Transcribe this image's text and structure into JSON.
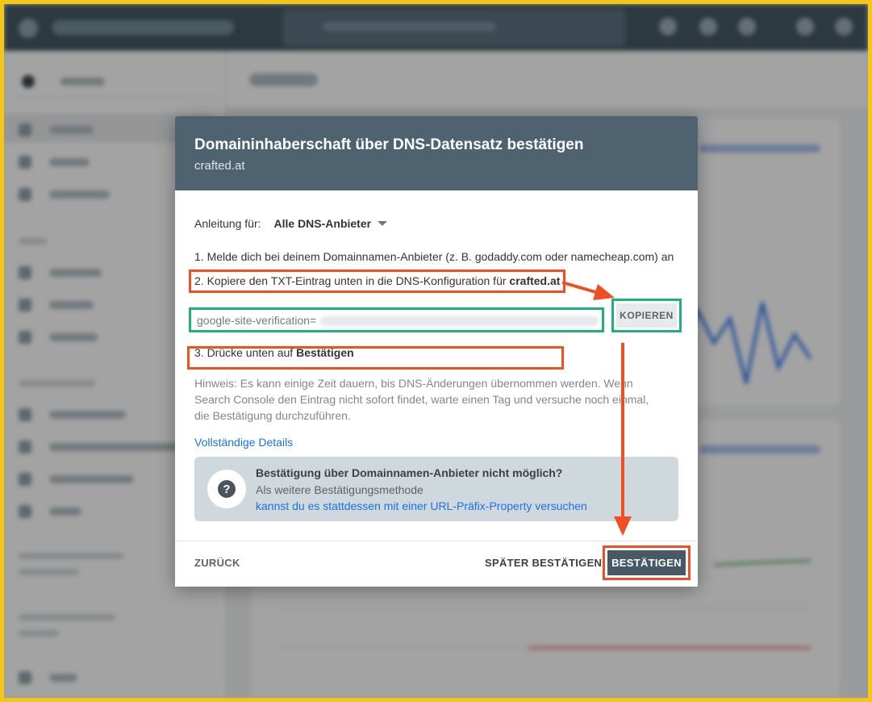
{
  "dialog": {
    "title": "Domaininhaberschaft über DNS-Datensatz bestätigen",
    "subtitle": "crafted.at",
    "instructions_label": "Anleitung für:",
    "provider_selected": "Alle DNS-Anbieter",
    "step1": "1. Melde dich bei deinem Domainnamen-Anbieter (z. B. godaddy.com oder namecheap.com) an",
    "step2_prefix": "2. Kopiere den TXT-Eintrag unten in die DNS-Konfiguration für ",
    "step2_domain": "crafted.at",
    "txt_record_value": "google-site-verification=",
    "copy_button": "KOPIEREN",
    "step3_prefix": "3. Drücke unten auf ",
    "step3_bold": "Bestätigen",
    "hint": "Hinweis: Es kann einige Zeit dauern, bis DNS-Änderungen übernommen werden. Wenn Search Console den Eintrag nicht sofort findet, warte einen Tag und versuche noch einmal, die Bestätigung durchzuführen.",
    "details_link": "Vollständige Details",
    "info": {
      "title": "Bestätigung über Domainnamen-Anbieter nicht möglich?",
      "subtitle": "Als weitere Bestätigungsmethode",
      "link": "kannst du es stattdessen mit einer URL-Präfix-Property versuchen",
      "icon": "question-icon"
    },
    "footer": {
      "back": "ZURÜCK",
      "later": "SPÄTER BESTÄTIGEN",
      "confirm": "BESTÄTIGEN"
    }
  },
  "colors": {
    "frame": "#f5c518",
    "dialog_header": "#4f6270",
    "highlight_red": "#f04e23",
    "highlight_green": "#21b07a",
    "link": "#1a73e8",
    "confirm_button": "#455a64"
  }
}
